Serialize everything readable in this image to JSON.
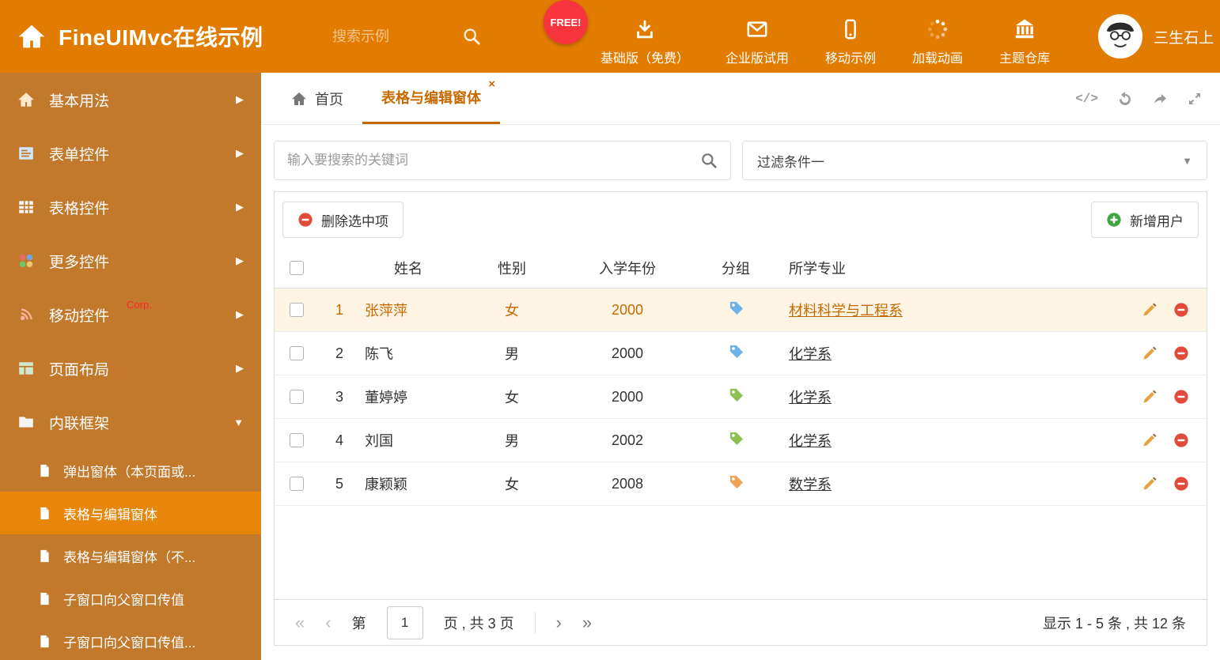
{
  "colors": {
    "header_bg": "#e17c00",
    "sidebar_bg": "#c3792b",
    "active_bg": "#e8860c",
    "accent": "#c66a00",
    "selected_row_bg": "#fdf4e3",
    "free_badge_bg": "#f8353f",
    "red": "#e04b3a",
    "green": "#3fa33f"
  },
  "header": {
    "title": "FineUIMvc在线示例",
    "search_placeholder": "搜索示例",
    "free_badge": "FREE!",
    "nav": [
      {
        "label": "基础版（免费）",
        "icon": "download-icon"
      },
      {
        "label": "企业版试用",
        "icon": "envelope-icon"
      },
      {
        "label": "移动示例",
        "icon": "mobile-icon"
      },
      {
        "label": "加载动画",
        "icon": "spinner-icon"
      },
      {
        "label": "主题仓库",
        "icon": "bank-icon"
      }
    ],
    "user": {
      "name": "三生石上",
      "avatar": "cartoon-face-avatar"
    }
  },
  "sidebar": {
    "items": [
      {
        "label": "基本用法",
        "icon": "home-icon"
      },
      {
        "label": "表单控件",
        "icon": "form-icon"
      },
      {
        "label": "表格控件",
        "icon": "table-icon"
      },
      {
        "label": "更多控件",
        "icon": "widgets-icon"
      },
      {
        "label": "移动控件",
        "badge": "Corp.",
        "icon": "signal-icon"
      },
      {
        "label": "页面布局",
        "icon": "layout-icon"
      },
      {
        "label": "内联框架",
        "icon": "folder-icon",
        "expanded": true
      }
    ],
    "subitems": [
      {
        "label": "弹出窗体（本页面或..."
      },
      {
        "label": "表格与编辑窗体",
        "active": true
      },
      {
        "label": "表格与编辑窗体（不..."
      },
      {
        "label": "子窗口向父窗口传值"
      },
      {
        "label": "子窗口向父窗口传值..."
      }
    ]
  },
  "tabs": {
    "home": {
      "label": "首页",
      "icon": "home-icon"
    },
    "active": {
      "label": "表格与编辑窗体",
      "closable": true
    }
  },
  "filters": {
    "search_placeholder": "输入要搜索的关键词",
    "filter_value": "过滤条件一"
  },
  "toolbar": {
    "delete_label": "删除选中项",
    "add_label": "新增用户"
  },
  "table": {
    "columns": {
      "name": "姓名",
      "gender": "性别",
      "year": "入学年份",
      "group": "分组",
      "major": "所学专业"
    },
    "rows": [
      {
        "num": "1",
        "name": "张萍萍",
        "gender": "女",
        "year": "2000",
        "tag_color": "#6db3e8",
        "major": "材料科学与工程系",
        "selected": true
      },
      {
        "num": "2",
        "name": "陈飞",
        "gender": "男",
        "year": "2000",
        "tag_color": "#6db3e8",
        "major": "化学系"
      },
      {
        "num": "3",
        "name": "董婷婷",
        "gender": "女",
        "year": "2000",
        "tag_color": "#8dc153",
        "major": "化学系"
      },
      {
        "num": "4",
        "name": "刘国",
        "gender": "男",
        "year": "2002",
        "tag_color": "#8dc153",
        "major": "化学系"
      },
      {
        "num": "5",
        "name": "康颖颖",
        "gender": "女",
        "year": "2008",
        "tag_color": "#f2a254",
        "major": "数学系"
      }
    ]
  },
  "pagination": {
    "page_prefix": "第",
    "page_value": "1",
    "page_suffix": "页 , 共 3 页",
    "summary": "显示 1 - 5 条 , 共 12 条"
  }
}
